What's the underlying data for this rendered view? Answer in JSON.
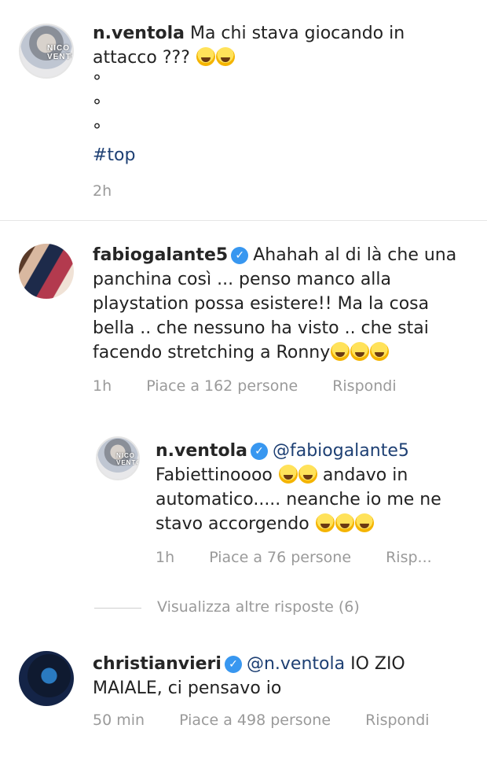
{
  "comments": [
    {
      "username": "n.ventola",
      "text": "Ma chi stava giocando in attacco ???",
      "dots": [
        "°",
        "°",
        "°"
      ],
      "hashtag": "#top",
      "time": "2h",
      "avatar_text": "NICO VENTOL"
    },
    {
      "username": "fabiogalante5",
      "verified": true,
      "text": "Ahahah al di là che una panchina così ... penso manco alla playstation possa esistere!! Ma la cosa bella .. che nessuno ha visto .. che stai facendo stretching a Ronny",
      "time": "1h",
      "likes": "Piace a 162 persone",
      "reply": "Rispondi"
    },
    {
      "username": "n.ventola",
      "verified": true,
      "mention": "@fabiogalante5",
      "text": "Fabiettinoooo",
      "text2": "andavo in automatico..... neanche io me ne stavo accorgendo",
      "time": "1h",
      "likes": "Piace a 76 persone",
      "reply": "Risp...",
      "avatar_text": "NICO VENTOL"
    },
    {
      "username": "christianvieri",
      "verified": true,
      "mention": "@n.ventola",
      "text": "IO ZIO MAIALE, ci pensavo io",
      "time": "50 min",
      "likes": "Piace a 498 persone",
      "reply": "Rispondi"
    }
  ],
  "view_more": "Visualizza altre risposte (6)",
  "colors": {
    "verified": "#3897f0",
    "link": "#1d3f73",
    "meta": "#9a9a9a"
  }
}
